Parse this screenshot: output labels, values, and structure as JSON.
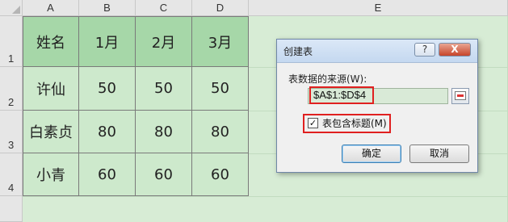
{
  "spreadsheet": {
    "column_headers": [
      "A",
      "B",
      "C",
      "D",
      "E"
    ],
    "row_headers": [
      "1",
      "2",
      "3",
      "4"
    ],
    "table": {
      "header": [
        "姓名",
        "1月",
        "2月",
        "3月"
      ],
      "rows": [
        [
          "许仙",
          "50",
          "50",
          "50"
        ],
        [
          "白素贞",
          "80",
          "80",
          "80"
        ],
        [
          "小青",
          "60",
          "60",
          "60"
        ]
      ]
    }
  },
  "dialog": {
    "title": "创建表",
    "help_button": "?",
    "close_button": "X",
    "source_label": "表数据的来源(W):",
    "range_value": "$A$1:$D$4",
    "checkbox_label": "表包含标题(M)",
    "checkbox_checked": true,
    "ok_label": "确定",
    "cancel_label": "取消"
  },
  "colors": {
    "table_header_fill": "#a6d7a8",
    "table_body_fill": "#cde9cc",
    "highlight_red": "#e02020"
  }
}
